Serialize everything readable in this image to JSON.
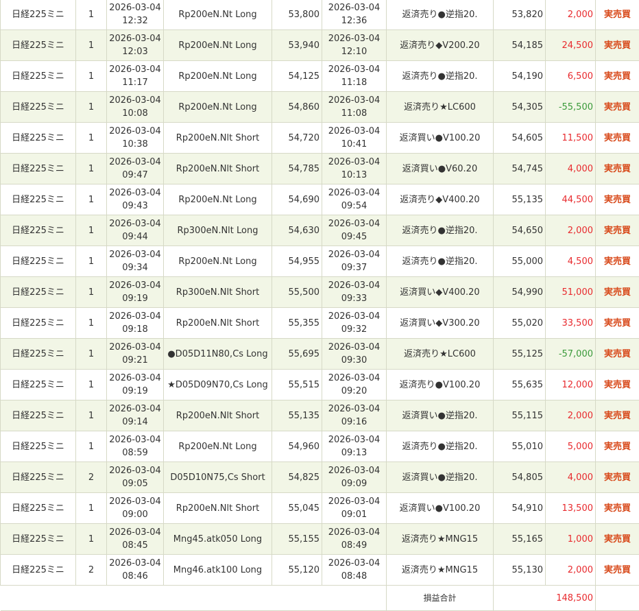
{
  "rows": [
    {
      "product": "日経225ミニ",
      "qty": "1",
      "entry_date": "2026-03-04",
      "entry_time": "12:32",
      "strategy": "Rp200eN.Nt Long",
      "entry_price": "53,800",
      "exit_date": "2026-03-04",
      "exit_time": "12:36",
      "exit_rule": "返済売り●逆指20.",
      "exit_price": "53,820",
      "pnl": "2,000",
      "sign": "pos",
      "kind": "実売買"
    },
    {
      "product": "日経225ミニ",
      "qty": "1",
      "entry_date": "2026-03-04",
      "entry_time": "12:03",
      "strategy": "Rp200eN.Nt Long",
      "entry_price": "53,940",
      "exit_date": "2026-03-04",
      "exit_time": "12:10",
      "exit_rule": "返済売り◆V200.20",
      "exit_price": "54,185",
      "pnl": "24,500",
      "sign": "pos",
      "kind": "実売買"
    },
    {
      "product": "日経225ミニ",
      "qty": "1",
      "entry_date": "2026-03-04",
      "entry_time": "11:17",
      "strategy": "Rp200eN.Nt Long",
      "entry_price": "54,125",
      "exit_date": "2026-03-04",
      "exit_time": "11:18",
      "exit_rule": "返済売り●逆指20.",
      "exit_price": "54,190",
      "pnl": "6,500",
      "sign": "pos",
      "kind": "実売買"
    },
    {
      "product": "日経225ミニ",
      "qty": "1",
      "entry_date": "2026-03-04",
      "entry_time": "10:08",
      "strategy": "Rp200eN.Nt Long",
      "entry_price": "54,860",
      "exit_date": "2026-03-04",
      "exit_time": "11:08",
      "exit_rule": "返済売り★LC600",
      "exit_price": "54,305",
      "pnl": "-55,500",
      "sign": "neg",
      "kind": "実売買"
    },
    {
      "product": "日経225ミニ",
      "qty": "1",
      "entry_date": "2026-03-04",
      "entry_time": "10:38",
      "strategy": "Rp200eN.Nlt Short",
      "entry_price": "54,720",
      "exit_date": "2026-03-04",
      "exit_time": "10:41",
      "exit_rule": "返済買い●V100.20",
      "exit_price": "54,605",
      "pnl": "11,500",
      "sign": "pos",
      "kind": "実売買"
    },
    {
      "product": "日経225ミニ",
      "qty": "1",
      "entry_date": "2026-03-04",
      "entry_time": "09:47",
      "strategy": "Rp200eN.Nlt Short",
      "entry_price": "54,785",
      "exit_date": "2026-03-04",
      "exit_time": "10:13",
      "exit_rule": "返済買い●V60.20",
      "exit_price": "54,745",
      "pnl": "4,000",
      "sign": "pos",
      "kind": "実売買"
    },
    {
      "product": "日経225ミニ",
      "qty": "1",
      "entry_date": "2026-03-04",
      "entry_time": "09:43",
      "strategy": "Rp200eN.Nt Long",
      "entry_price": "54,690",
      "exit_date": "2026-03-04",
      "exit_time": "09:54",
      "exit_rule": "返済売り◆V400.20",
      "exit_price": "55,135",
      "pnl": "44,500",
      "sign": "pos",
      "kind": "実売買"
    },
    {
      "product": "日経225ミニ",
      "qty": "1",
      "entry_date": "2026-03-04",
      "entry_time": "09:44",
      "strategy": "Rp300eN.Nlt Long",
      "entry_price": "54,630",
      "exit_date": "2026-03-04",
      "exit_time": "09:45",
      "exit_rule": "返済売り●逆指20.",
      "exit_price": "54,650",
      "pnl": "2,000",
      "sign": "pos",
      "kind": "実売買"
    },
    {
      "product": "日経225ミニ",
      "qty": "1",
      "entry_date": "2026-03-04",
      "entry_time": "09:34",
      "strategy": "Rp200eN.Nt Long",
      "entry_price": "54,955",
      "exit_date": "2026-03-04",
      "exit_time": "09:37",
      "exit_rule": "返済売り●逆指20.",
      "exit_price": "55,000",
      "pnl": "4,500",
      "sign": "pos",
      "kind": "実売買"
    },
    {
      "product": "日経225ミニ",
      "qty": "1",
      "entry_date": "2026-03-04",
      "entry_time": "09:19",
      "strategy": "Rp300eN.Nlt Short",
      "entry_price": "55,500",
      "exit_date": "2026-03-04",
      "exit_time": "09:33",
      "exit_rule": "返済買い◆V400.20",
      "exit_price": "54,990",
      "pnl": "51,000",
      "sign": "pos",
      "kind": "実売買"
    },
    {
      "product": "日経225ミニ",
      "qty": "1",
      "entry_date": "2026-03-04",
      "entry_time": "09:18",
      "strategy": "Rp200eN.Nlt Short",
      "entry_price": "55,355",
      "exit_date": "2026-03-04",
      "exit_time": "09:32",
      "exit_rule": "返済買い◆V300.20",
      "exit_price": "55,020",
      "pnl": "33,500",
      "sign": "pos",
      "kind": "実売買"
    },
    {
      "product": "日経225ミニ",
      "qty": "1",
      "entry_date": "2026-03-04",
      "entry_time": "09:21",
      "strategy": "●D05D11N80,Cs Long",
      "entry_price": "55,695",
      "exit_date": "2026-03-04",
      "exit_time": "09:30",
      "exit_rule": "返済売り★LC600",
      "exit_price": "55,125",
      "pnl": "-57,000",
      "sign": "neg",
      "kind": "実売買"
    },
    {
      "product": "日経225ミニ",
      "qty": "1",
      "entry_date": "2026-03-04",
      "entry_time": "09:19",
      "strategy": "★D05D09N70,Cs Long",
      "entry_price": "55,515",
      "exit_date": "2026-03-04",
      "exit_time": "09:20",
      "exit_rule": "返済売り●V100.20",
      "exit_price": "55,635",
      "pnl": "12,000",
      "sign": "pos",
      "kind": "実売買"
    },
    {
      "product": "日経225ミニ",
      "qty": "1",
      "entry_date": "2026-03-04",
      "entry_time": "09:14",
      "strategy": "Rp200eN.Nlt Short",
      "entry_price": "55,135",
      "exit_date": "2026-03-04",
      "exit_time": "09:16",
      "exit_rule": "返済買い●逆指20.",
      "exit_price": "55,115",
      "pnl": "2,000",
      "sign": "pos",
      "kind": "実売買"
    },
    {
      "product": "日経225ミニ",
      "qty": "1",
      "entry_date": "2026-03-04",
      "entry_time": "08:59",
      "strategy": "Rp200eN.Nt Long",
      "entry_price": "54,960",
      "exit_date": "2026-03-04",
      "exit_time": "09:13",
      "exit_rule": "返済売り●逆指20.",
      "exit_price": "55,010",
      "pnl": "5,000",
      "sign": "pos",
      "kind": "実売買"
    },
    {
      "product": "日経225ミニ",
      "qty": "2",
      "entry_date": "2026-03-04",
      "entry_time": "09:05",
      "strategy": "D05D10N75,Cs Short",
      "entry_price": "54,825",
      "exit_date": "2026-03-04",
      "exit_time": "09:09",
      "exit_rule": "返済買い●逆指20.",
      "exit_price": "54,805",
      "pnl": "4,000",
      "sign": "pos",
      "kind": "実売買"
    },
    {
      "product": "日経225ミニ",
      "qty": "1",
      "entry_date": "2026-03-04",
      "entry_time": "09:00",
      "strategy": "Rp200eN.Nlt Short",
      "entry_price": "55,045",
      "exit_date": "2026-03-04",
      "exit_time": "09:01",
      "exit_rule": "返済買い●V100.20",
      "exit_price": "54,910",
      "pnl": "13,500",
      "sign": "pos",
      "kind": "実売買"
    },
    {
      "product": "日経225ミニ",
      "qty": "1",
      "entry_date": "2026-03-04",
      "entry_time": "08:45",
      "strategy": "Mng45.atk050 Long",
      "entry_price": "55,155",
      "exit_date": "2026-03-04",
      "exit_time": "08:49",
      "exit_rule": "返済売り★MNG15",
      "exit_price": "55,165",
      "pnl": "1,000",
      "sign": "pos",
      "kind": "実売買"
    },
    {
      "product": "日経225ミニ",
      "qty": "2",
      "entry_date": "2026-03-04",
      "entry_time": "08:46",
      "strategy": "Mng46.atk100 Long",
      "entry_price": "55,120",
      "exit_date": "2026-03-04",
      "exit_time": "08:48",
      "exit_rule": "返済売り★MNG15",
      "exit_price": "55,130",
      "pnl": "2,000",
      "sign": "pos",
      "kind": "実売買"
    }
  ],
  "summary": {
    "label": "損益合計",
    "total": "148,500"
  },
  "colors": {
    "positive": "#e8292d",
    "negative": "#3a9a3a",
    "kind": "#d84a1b",
    "stripe": "#f2f6e6",
    "border": "#d6d9c6"
  }
}
